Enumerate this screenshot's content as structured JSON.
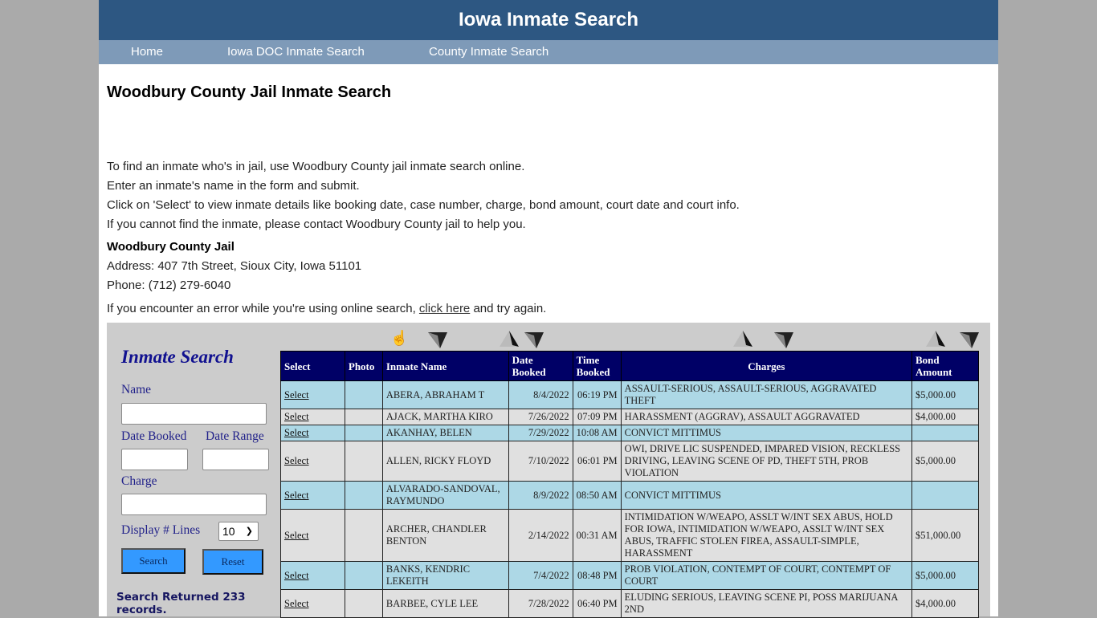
{
  "site": {
    "title": "Iowa Inmate Search",
    "nav": [
      {
        "label": "Home"
      },
      {
        "label": "Iowa DOC Inmate Search"
      },
      {
        "label": "County Inmate Search"
      }
    ]
  },
  "page": {
    "heading": "Woodbury County Jail Inmate Search",
    "intro": [
      "To find an inmate who's in jail, use Woodbury County jail inmate search online.",
      "Enter an inmate's name in the form and submit.",
      "Click on 'Select' to view inmate details like booking date, case number, charge, bond amount, court date and court info.",
      "If you cannot find the inmate, please contact Woodbury County jail to help you."
    ],
    "jail": {
      "name": "Woodbury County Jail",
      "address": "Address: 407 7th Street, Sioux City, Iowa 51101",
      "phone": "Phone: (712) 279-6040"
    },
    "error_line": {
      "before": "If you encounter an error while you're using online search, ",
      "link": "click here",
      "after": " and try again."
    }
  },
  "search_form": {
    "title": "Inmate Search",
    "name_label": "Name",
    "name_value": "",
    "date_booked_label": "Date Booked",
    "date_booked_value": "",
    "date_range_label": "Date Range",
    "date_range_value": "",
    "charge_label": "Charge",
    "charge_value": "",
    "display_lines_label": "Display # Lines",
    "display_lines_value": "10",
    "search_button": "Search",
    "reset_button": "Reset",
    "result_text": "Search Returned 233 records."
  },
  "table": {
    "headers": [
      "Select",
      "Photo",
      "Inmate Name",
      "Date Booked",
      "Time Booked",
      "Charges",
      "Bond Amount"
    ],
    "rows": [
      {
        "select": "Select",
        "photo": "",
        "name": "ABERA, ABRAHAM T",
        "date": "8/4/2022",
        "time": "06:19 PM",
        "charges": "ASSAULT-SERIOUS, ASSAULT-SERIOUS, AGGRAVATED THEFT",
        "bond": "$5,000.00"
      },
      {
        "select": "Select",
        "photo": "",
        "name": "AJACK, MARTHA KIRO",
        "date": "7/26/2022",
        "time": "07:09 PM",
        "charges": "HARASSMENT (AGGRAV), ASSAULT AGGRAVATED",
        "bond": "$4,000.00"
      },
      {
        "select": "Select",
        "photo": "",
        "name": "AKANHAY, BELEN",
        "date": "7/29/2022",
        "time": "10:08 AM",
        "charges": "CONVICT MITTIMUS",
        "bond": ""
      },
      {
        "select": "Select",
        "photo": "",
        "name": "ALLEN, RICKY FLOYD",
        "date": "7/10/2022",
        "time": "06:01 PM",
        "charges": "OWI, DRIVE LIC SUSPENDED, IMPARED VISION, RECKLESS DRIVING, LEAVING SCENE OF PD, THEFT 5TH, PROB VIOLATION",
        "bond": "$5,000.00"
      },
      {
        "select": "Select",
        "photo": "",
        "name": "ALVARADO-SANDOVAL, RAYMUNDO",
        "date": "8/9/2022",
        "time": "08:50 AM",
        "charges": "CONVICT MITTIMUS",
        "bond": ""
      },
      {
        "select": "Select",
        "photo": "",
        "name": "ARCHER, CHANDLER BENTON",
        "date": "2/14/2022",
        "time": "00:31 AM",
        "charges": "INTIMIDATION W/WEAPO, ASSLT W/INT SEX ABUS, HOLD FOR IOWA, INTIMIDATION W/WEAPO, ASSLT W/INT SEX ABUS, TRAFFIC STOLEN FIREA, ASSAULT-SIMPLE, HARASSMENT",
        "bond": "$51,000.00"
      },
      {
        "select": "Select",
        "photo": "",
        "name": "BANKS, KENDRIC LEKEITH",
        "date": "7/4/2022",
        "time": "08:48 PM",
        "charges": "PROB VIOLATION, CONTEMPT OF COURT, CONTEMPT OF COURT",
        "bond": "$5,000.00"
      },
      {
        "select": "Select",
        "photo": "",
        "name": "BARBEE, CYLE LEE",
        "date": "7/28/2022",
        "time": "06:40 PM",
        "charges": "ELUDING SERIOUS, LEAVING SCENE PI, POSS MARIJUANA 2ND",
        "bond": "$4,000.00"
      }
    ]
  }
}
